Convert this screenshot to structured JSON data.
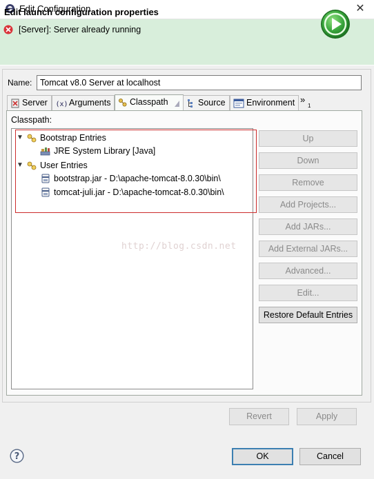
{
  "window": {
    "title": "Edit Configuration",
    "close_glyph": "✕",
    "app_icon": "eclipse-icon"
  },
  "banner": {
    "title": "Edit launch configuration properties",
    "message": "[Server]: Server already running",
    "status_icon": "error-icon",
    "action_icon": "run-icon"
  },
  "form": {
    "name_label": "Name:",
    "name_value": "Tomcat v8.0 Server at localhost"
  },
  "tabs": [
    {
      "label": "Server",
      "icon": "server-tab-icon",
      "active": false
    },
    {
      "label": "Arguments",
      "icon": "arguments-tab-icon",
      "active": false
    },
    {
      "label": "Classpath",
      "icon": "classpath-tab-icon",
      "active": true
    },
    {
      "label": "Source",
      "icon": "source-tab-icon",
      "active": false
    },
    {
      "label": "Environment",
      "icon": "environment-tab-icon",
      "active": false
    }
  ],
  "tabs_overflow": {
    "glyph": "»",
    "count": "1"
  },
  "classpath": {
    "label": "Classpath:",
    "tree": [
      {
        "label": "Bootstrap Entries",
        "icon": "entries-group-icon",
        "expanded": true,
        "level": 0
      },
      {
        "label": "JRE System Library [Java]",
        "icon": "library-icon",
        "level": 1
      },
      {
        "label": "User Entries",
        "icon": "entries-group-icon",
        "expanded": true,
        "level": 0
      },
      {
        "label": "bootstrap.jar - D:\\apache-tomcat-8.0.30\\bin\\",
        "icon": "jar-icon",
        "level": 1
      },
      {
        "label": "tomcat-juli.jar - D:\\apache-tomcat-8.0.30\\bin\\",
        "icon": "jar-icon",
        "level": 1
      }
    ],
    "watermark": "http://blog.csdn.net"
  },
  "side_buttons": [
    {
      "label": "Up",
      "enabled": false
    },
    {
      "label": "Down",
      "enabled": false
    },
    {
      "label": "Remove",
      "enabled": false
    },
    {
      "label": "Add Projects...",
      "enabled": false
    },
    {
      "label": "Add JARs...",
      "enabled": false
    },
    {
      "label": "Add External JARs...",
      "enabled": false
    },
    {
      "label": "Advanced...",
      "enabled": false
    },
    {
      "label": "Edit...",
      "enabled": false
    },
    {
      "label": "Restore Default Entries",
      "enabled": true
    }
  ],
  "panel_buttons": {
    "revert": "Revert",
    "apply": "Apply"
  },
  "dialog_buttons": {
    "ok": "OK",
    "cancel": "Cancel",
    "help_icon": "help-icon"
  },
  "colors": {
    "banner_bg": "#d8eedb",
    "error_red": "#d9343a",
    "run_green": "#3aa63d",
    "highlight_red": "#cc2b2b",
    "default_button_border": "#3c7fb1"
  }
}
